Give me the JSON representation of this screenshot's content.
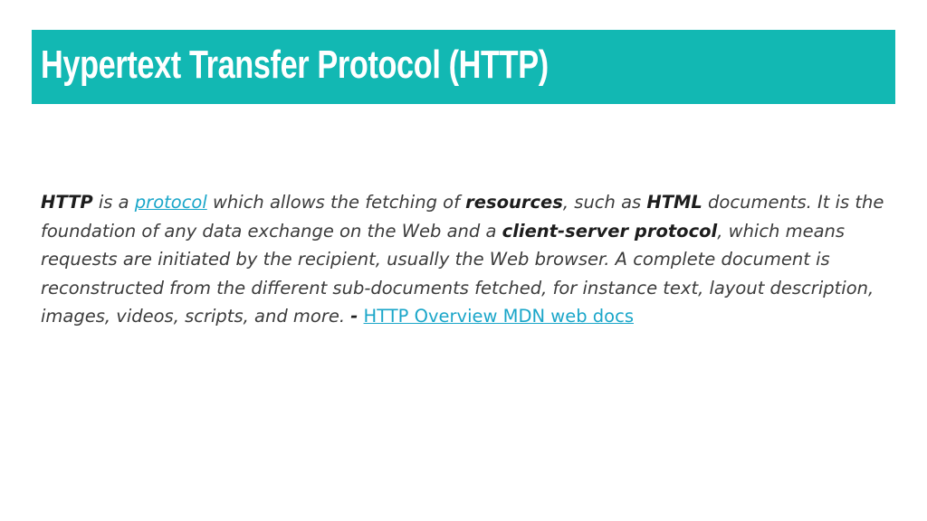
{
  "slide": {
    "title": "Hypertext Transfer Protocol (HTTP)",
    "accent_color": "#12b8b3",
    "link_color": "#1aa6c9"
  },
  "body": {
    "term_http": "HTTP",
    "t1": " is a ",
    "link_protocol": "protocol",
    "t2": " which allows the fetching of ",
    "term_resources": "resources",
    "t3": ", such as ",
    "term_html": "HTML",
    "t4": " documents. It is the foundation of any data exchange on the Web and a ",
    "term_client_server": "client-server protocol",
    "t5": ", which means requests are initiated by the recipient, usually the Web browser. A complete document is reconstructed from the different sub-documents fetched, for instance text, layout description, images, videos, scripts, and more. ",
    "dash": "-",
    "t6": " ",
    "link_source": "HTTP Overview MDN web docs"
  }
}
